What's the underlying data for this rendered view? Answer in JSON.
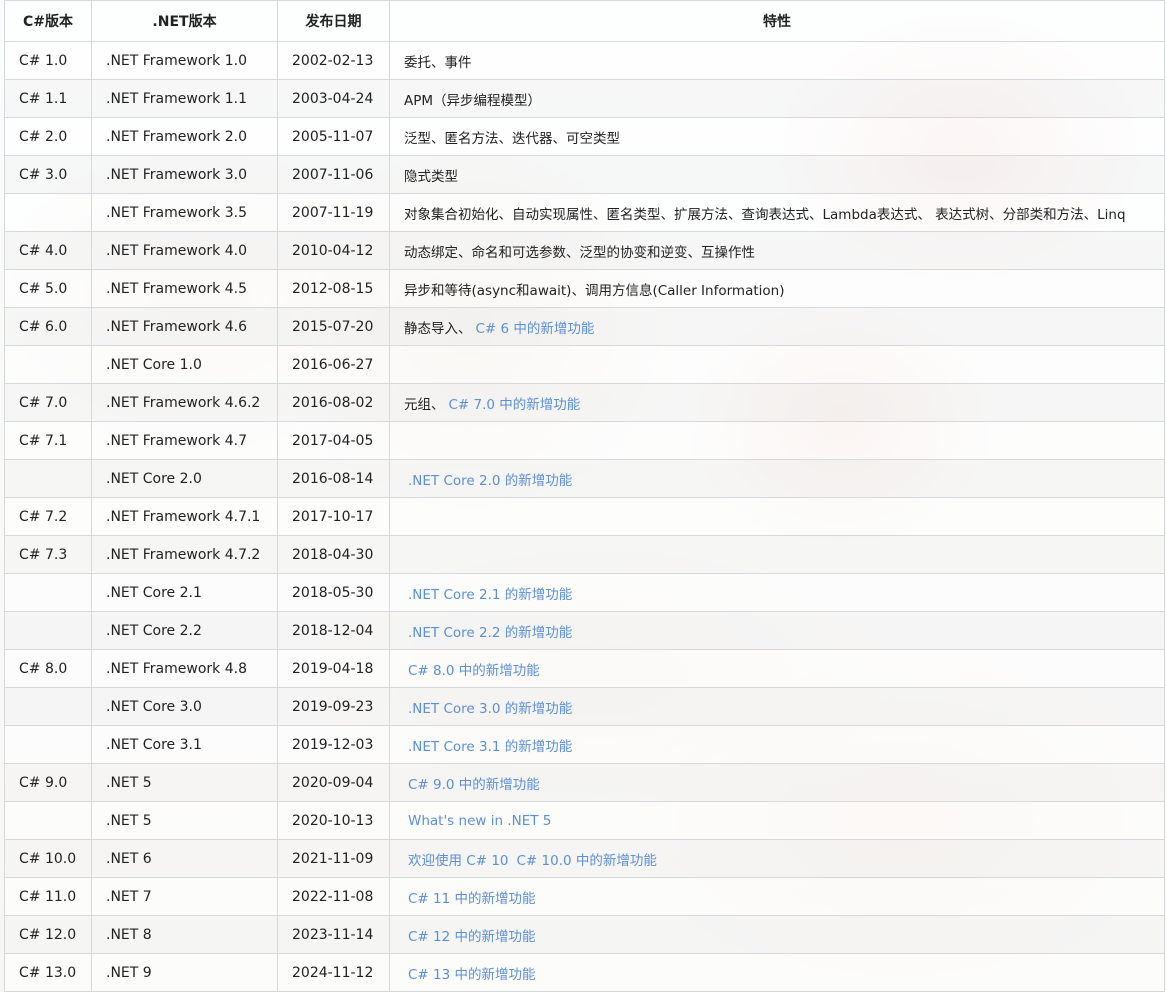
{
  "table": {
    "headers": [
      "C#版本",
      ".NET版本",
      "发布日期",
      "特性"
    ],
    "rows": [
      {
        "cs": "C# 1.0",
        "net": ".NET Framework 1.0",
        "date": "2002-02-13",
        "feature": [
          {
            "text": "委托、事件",
            "link": false
          }
        ]
      },
      {
        "cs": "C# 1.1",
        "net": ".NET Framework 1.1",
        "date": "2003-04-24",
        "feature": [
          {
            "text": "APM（异步编程模型）",
            "link": false
          }
        ]
      },
      {
        "cs": "C# 2.0",
        "net": ".NET Framework 2.0",
        "date": "2005-11-07",
        "feature": [
          {
            "text": "泛型、匿名方法、迭代器、可空类型",
            "link": false
          }
        ]
      },
      {
        "cs": "C# 3.0",
        "net": ".NET Framework 3.0",
        "date": "2007-11-06",
        "feature": [
          {
            "text": "隐式类型",
            "link": false
          }
        ]
      },
      {
        "cs": "",
        "net": ".NET Framework 3.5",
        "date": "2007-11-19",
        "feature": [
          {
            "text": "对象集合初始化、自动实现属性、匿名类型、扩展方法、查询表达式、Lambda表达式、 表达式树、分部类和方法、Linq",
            "link": false
          }
        ]
      },
      {
        "cs": "C# 4.0",
        "net": ".NET Framework 4.0",
        "date": "2010-04-12",
        "feature": [
          {
            "text": "动态绑定、命名和可选参数、泛型的协变和逆变、互操作性",
            "link": false
          }
        ]
      },
      {
        "cs": "C# 5.0",
        "net": ".NET Framework 4.5",
        "date": "2012-08-15",
        "feature": [
          {
            "text": "异步和等待(async和await)、调用方信息(Caller Information)",
            "link": false
          }
        ]
      },
      {
        "cs": "C# 6.0",
        "net": ".NET Framework 4.6",
        "date": "2015-07-20",
        "feature": [
          {
            "text": "静态导入、",
            "link": false
          },
          {
            "text": "C# 6 中的新增功能",
            "link": true
          }
        ]
      },
      {
        "cs": "",
        "net": ".NET Core 1.0",
        "date": "2016-06-27",
        "feature": []
      },
      {
        "cs": "C# 7.0",
        "net": ".NET Framework 4.6.2",
        "date": "2016-08-02",
        "feature": [
          {
            "text": "元组、",
            "link": false
          },
          {
            "text": "C# 7.0 中的新增功能",
            "link": true
          }
        ]
      },
      {
        "cs": "C# 7.1",
        "net": ".NET Framework 4.7",
        "date": "2017-04-05",
        "feature": []
      },
      {
        "cs": "",
        "net": ".NET Core 2.0",
        "date": "2016-08-14",
        "feature": [
          {
            "text": ".NET Core 2.0 的新增功能",
            "link": true
          }
        ]
      },
      {
        "cs": "C# 7.2",
        "net": ".NET Framework 4.7.1",
        "date": "2017-10-17",
        "feature": []
      },
      {
        "cs": "C# 7.3",
        "net": ".NET Framework 4.7.2",
        "date": "2018-04-30",
        "feature": []
      },
      {
        "cs": "",
        "net": ".NET Core 2.1",
        "date": "2018-05-30",
        "feature": [
          {
            "text": ".NET Core 2.1 的新增功能",
            "link": true
          }
        ]
      },
      {
        "cs": "",
        "net": ".NET Core 2.2",
        "date": "2018-12-04",
        "feature": [
          {
            "text": ".NET Core 2.2 的新增功能",
            "link": true
          }
        ]
      },
      {
        "cs": "C# 8.0",
        "net": ".NET Framework 4.8",
        "date": "2019-04-18",
        "feature": [
          {
            "text": "C# 8.0 中的新增功能",
            "link": true
          }
        ]
      },
      {
        "cs": "",
        "net": ".NET Core 3.0",
        "date": "2019-09-23",
        "feature": [
          {
            "text": ".NET Core 3.0 的新增功能",
            "link": true
          }
        ]
      },
      {
        "cs": "",
        "net": ".NET Core 3.1",
        "date": "2019-12-03",
        "feature": [
          {
            "text": ".NET Core 3.1 的新增功能",
            "link": true
          }
        ]
      },
      {
        "cs": "C# 9.0",
        "net": ".NET 5",
        "date": "2020-09-04",
        "feature": [
          {
            "text": "C# 9.0 中的新增功能",
            "link": true
          }
        ]
      },
      {
        "cs": "",
        "net": ".NET 5",
        "date": "2020-10-13",
        "feature": [
          {
            "text": "What's new in .NET 5",
            "link": true
          }
        ]
      },
      {
        "cs": "C# 10.0",
        "net": ".NET 6",
        "date": "2021-11-09",
        "feature": [
          {
            "text": "欢迎使用 C# 10",
            "link": true
          },
          {
            "text": "C# 10.0 中的新增功能",
            "link": true
          }
        ]
      },
      {
        "cs": "C# 11.0",
        "net": ".NET 7",
        "date": "2022-11-08",
        "feature": [
          {
            "text": "C# 11 中的新增功能",
            "link": true
          }
        ]
      },
      {
        "cs": "C# 12.0",
        "net": ".NET 8",
        "date": "2023-11-14",
        "feature": [
          {
            "text": "C# 12 中的新增功能",
            "link": true
          }
        ]
      },
      {
        "cs": "C# 13.0",
        "net": ".NET 9",
        "date": "2024-11-12",
        "feature": [
          {
            "text": "C# 13 中的新增功能",
            "link": true
          }
        ]
      }
    ]
  }
}
